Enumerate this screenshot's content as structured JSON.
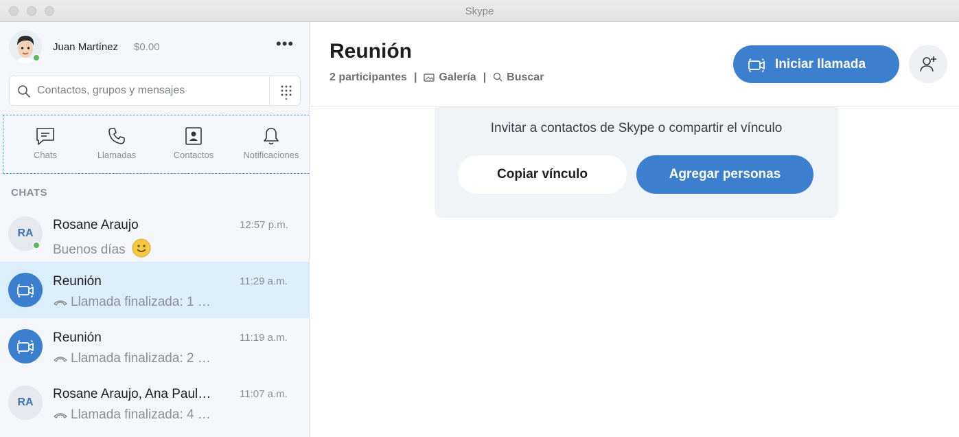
{
  "window": {
    "title": "Skype"
  },
  "profile": {
    "name": "Juan Martínez",
    "credit": "$0.00",
    "more_label": "•••"
  },
  "search": {
    "placeholder": "Contactos, grupos y mensajes"
  },
  "nav": [
    {
      "label": "Chats",
      "icon": "chat-icon"
    },
    {
      "label": "Llamadas",
      "icon": "phone-icon"
    },
    {
      "label": "Contactos",
      "icon": "contacts-icon"
    },
    {
      "label": "Notificaciones",
      "icon": "bell-icon"
    }
  ],
  "chats_section": {
    "title": "CHATS"
  },
  "chats": [
    {
      "name": "Rosane Araujo",
      "time": "12:57 p.m.",
      "message": "Buenos días",
      "initials": "RA",
      "online": true,
      "emoji": "smile-emoji",
      "selected": false
    },
    {
      "name": "Reunión",
      "time": "11:29 a.m.",
      "message": "Llamada finalizada: 1 …",
      "avatar_icon": "video-group-icon",
      "selected": true
    },
    {
      "name": "Reunión",
      "time": "11:19 a.m.",
      "message": "Llamada finalizada: 2 …",
      "avatar_icon": "video-group-icon",
      "selected": false
    },
    {
      "name": "Rosane Araujo, Ana Paul…",
      "time": "11:07 a.m.",
      "message": "Llamada finalizada: 4 …",
      "initials": "RA",
      "selected": false
    }
  ],
  "conversation": {
    "title": "Reunión",
    "participants": "2 participantes",
    "gallery": "Galería",
    "search": "Buscar",
    "call_button": "Iniciar llamada",
    "invite_message": "Invitar a contactos de Skype o compartir el vínculo",
    "copy_link": "Copiar vínculo",
    "add_people": "Agregar personas"
  },
  "colors": {
    "accent": "#3d7fcf",
    "selected_row": "#dbeefb",
    "online": "#5cb85c",
    "nav_highlight": "#2fa6d8"
  }
}
